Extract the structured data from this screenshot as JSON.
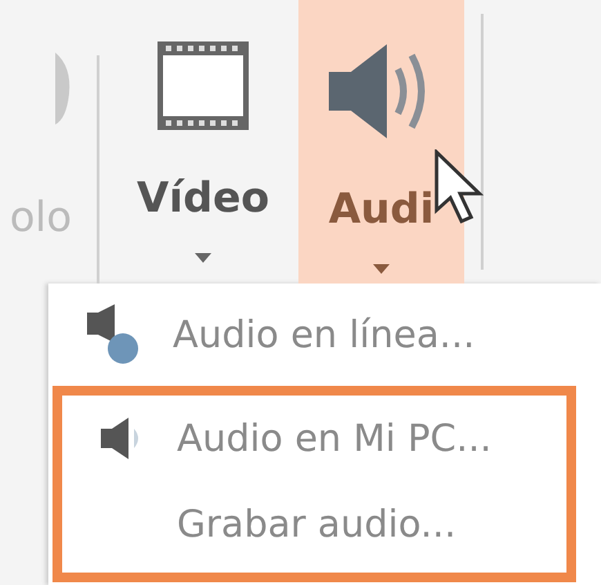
{
  "ribbon": {
    "buttons": [
      {
        "label": "olo",
        "kind": "partial",
        "selected": false
      },
      {
        "label": "Vídeo",
        "kind": "video",
        "selected": false
      },
      {
        "label": "Audi",
        "kind": "audio",
        "selected": true
      }
    ]
  },
  "menu": {
    "items": [
      {
        "label": "Audio en línea...",
        "kind": "online",
        "highlighted": false
      },
      {
        "label": "Audio en Mi PC...",
        "kind": "pc",
        "highlighted": true
      },
      {
        "label": "Grabar audio...",
        "kind": "record",
        "highlighted": true
      }
    ]
  }
}
